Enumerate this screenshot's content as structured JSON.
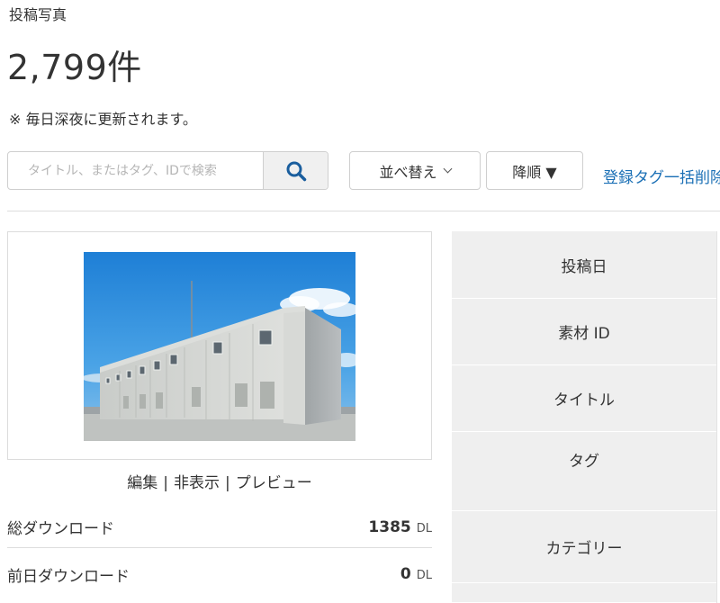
{
  "header": {
    "section_title": "投稿写真",
    "count": "2,799件",
    "note": "※ 毎日深夜に更新されます。"
  },
  "toolbar": {
    "search_placeholder": "タイトル、またはタグ、IDで検索",
    "search_icon": "magnifier-icon",
    "sort_label": "並べ替え",
    "order_label": "降順 ▼",
    "bulk_link": "登録タグ一括削除"
  },
  "item": {
    "thumbnail_subject": "photo-thumbnail",
    "actions": {
      "edit": "編集",
      "separator": "|",
      "hide": "非表示",
      "preview": "プレビュー"
    },
    "stats": [
      {
        "label": "総ダウンロード",
        "value": "1385",
        "unit": "DL"
      },
      {
        "label": "前日ダウンロード",
        "value": "0",
        "unit": "DL"
      }
    ]
  },
  "info_table": {
    "rows": [
      "投稿日",
      "素材 ID",
      "タイトル",
      "タグ",
      "カテゴリー"
    ]
  },
  "colors": {
    "link": "#1a6fb5",
    "table_bg": "#efefef",
    "border": "#dcdcdc"
  }
}
